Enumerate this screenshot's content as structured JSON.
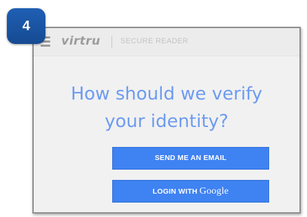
{
  "step_badge": "4",
  "header": {
    "brand": "virtru",
    "product": "SECURE READER"
  },
  "main": {
    "headline_line1": "How should we verify",
    "headline_line2": "your identity?",
    "email_button": "SEND ME AN EMAIL",
    "google_button_prefix": "LOGIN WITH",
    "google_button_brand": "Google"
  },
  "colors": {
    "accent_text": "#6d9bf0",
    "button_blue": "#3f82f2",
    "badge_blue": "#1f5fb4"
  },
  "icons": {
    "menu": "hamburger-menu-icon"
  }
}
